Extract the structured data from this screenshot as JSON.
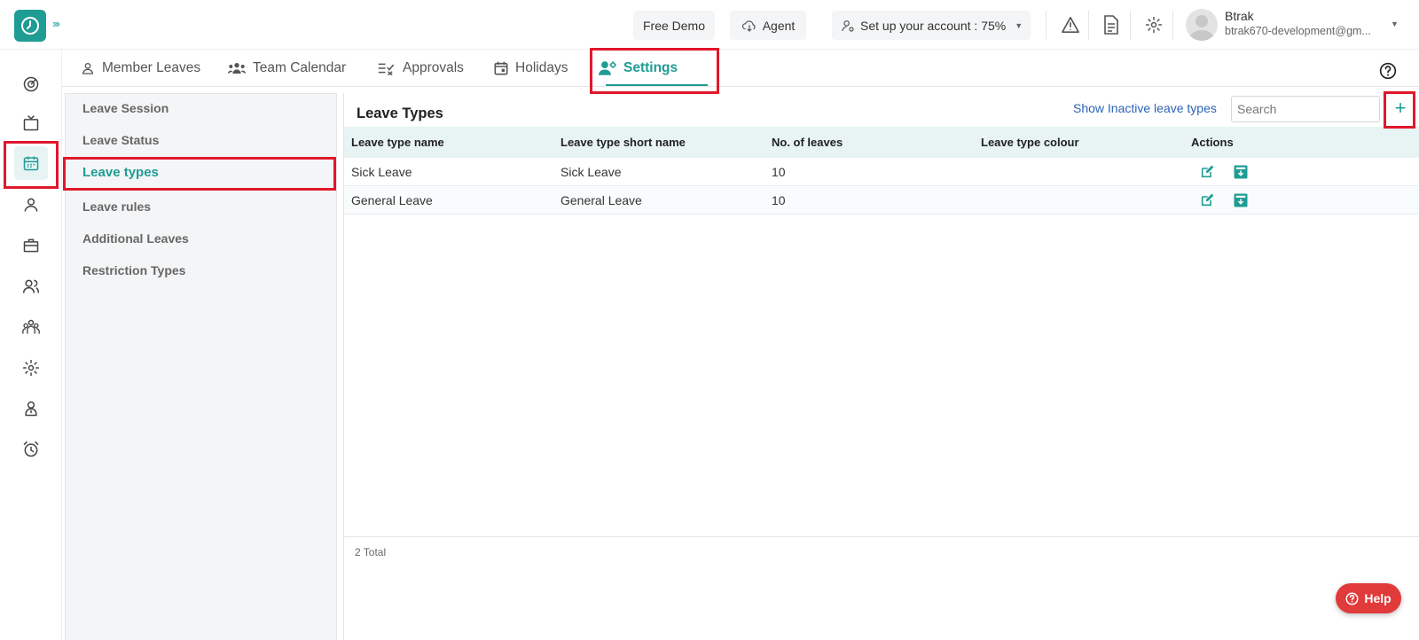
{
  "colors": {
    "accent": "#1f9c94",
    "link": "#2c62b8",
    "highlight": "#e0182c",
    "help": "#e03a3a"
  },
  "topbar": {
    "free_demo": "Free Demo",
    "agent": "Agent",
    "setup": "Set up your account : 75%",
    "user_name": "Btrak",
    "user_email": "btrak670-development@gm..."
  },
  "rail": {
    "icons": [
      "dashboard-icon",
      "tv-icon",
      "calendar-icon",
      "user-icon",
      "briefcase-icon",
      "users-icon",
      "team-icon",
      "gear-icon",
      "profile-icon",
      "alarm-icon"
    ]
  },
  "tabs": [
    {
      "label": "Member Leaves",
      "icon": "user-icon"
    },
    {
      "label": "Team Calendar",
      "icon": "team-icon"
    },
    {
      "label": "Approvals",
      "icon": "approvals-icon"
    },
    {
      "label": "Holidays",
      "icon": "calendar-icon"
    },
    {
      "label": "Settings",
      "icon": "user-settings-icon"
    }
  ],
  "menu": [
    {
      "label": "Leave Session"
    },
    {
      "label": "Leave Status"
    },
    {
      "label": "Leave types"
    },
    {
      "label": "Leave rules"
    },
    {
      "label": "Additional Leaves"
    },
    {
      "label": "Restriction Types"
    }
  ],
  "panel": {
    "title": "Leave Types",
    "show_inactive": "Show Inactive leave types",
    "search_placeholder": "Search",
    "add": "+",
    "columns": [
      "Leave type name",
      "Leave type short name",
      "No. of leaves",
      "Leave type colour",
      "Actions"
    ],
    "rows": [
      {
        "name": "Sick Leave",
        "short": "Sick Leave",
        "count": "10",
        "colour": ""
      },
      {
        "name": "General Leave",
        "short": "General Leave",
        "count": "10",
        "colour": ""
      }
    ],
    "total": "2 Total"
  },
  "help": "Help"
}
